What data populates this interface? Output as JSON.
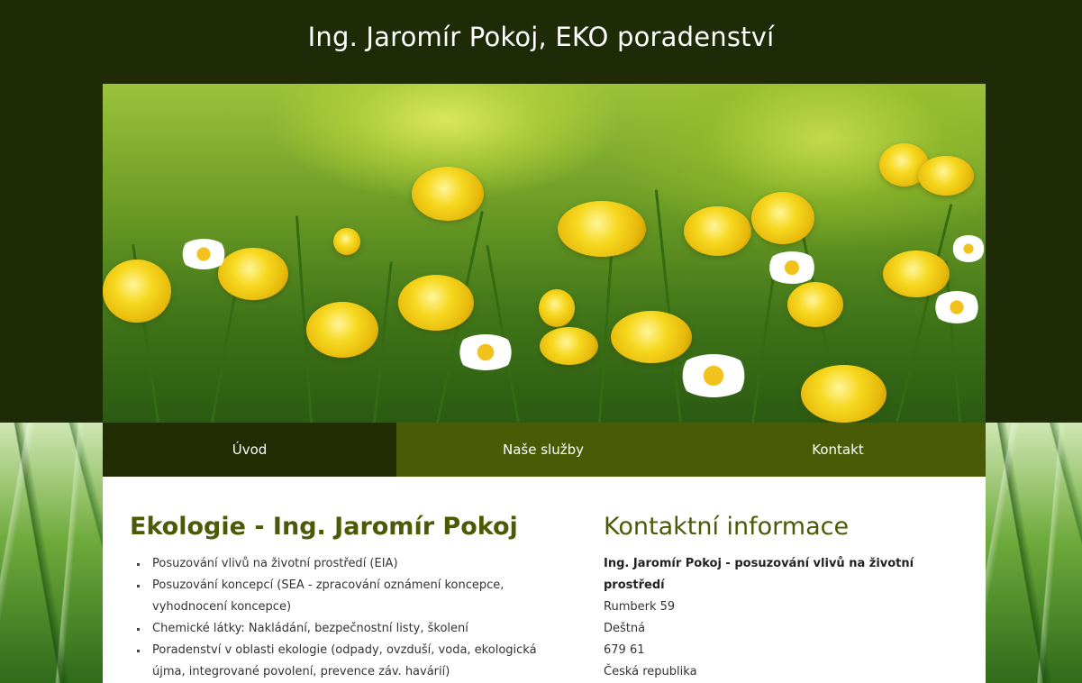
{
  "header": {
    "title": "Ing. Jaromír Pokoj, EKO poradenství"
  },
  "nav": {
    "items": [
      {
        "label": "Úvod",
        "active": true
      },
      {
        "label": "Naše služby",
        "active": false
      },
      {
        "label": "Kontakt",
        "active": false
      }
    ]
  },
  "main": {
    "heading": "Ekologie - Ing. Jaromír Pokoj",
    "services": [
      "Posuzování vlivů na životní prostředí (EIA)",
      "Posuzování koncepcí (SEA - zpracování oznámení koncepce, vyhodnocení koncepce)",
      "Chemické látky: Nakládání, bezpečnostní listy, školení",
      "Poradenství v oblasti ekologie (odpady, ovzduší, voda, ekologická újma, integrované povolení, prevence záv. havárií)"
    ]
  },
  "contact": {
    "heading": "Kontaktní informace",
    "name": "Ing. Jaromír Pokoj - posuzování vlivů na životní prostředí",
    "street": "Rumberk 59",
    "city": "Deštná",
    "zip": "679 61",
    "country": "Česká republika"
  },
  "colors": {
    "header_bg": "#1f2a06",
    "nav_bg": "#4a5b06",
    "nav_active_bg": "#222d04",
    "heading_color": "#4a5b06"
  }
}
